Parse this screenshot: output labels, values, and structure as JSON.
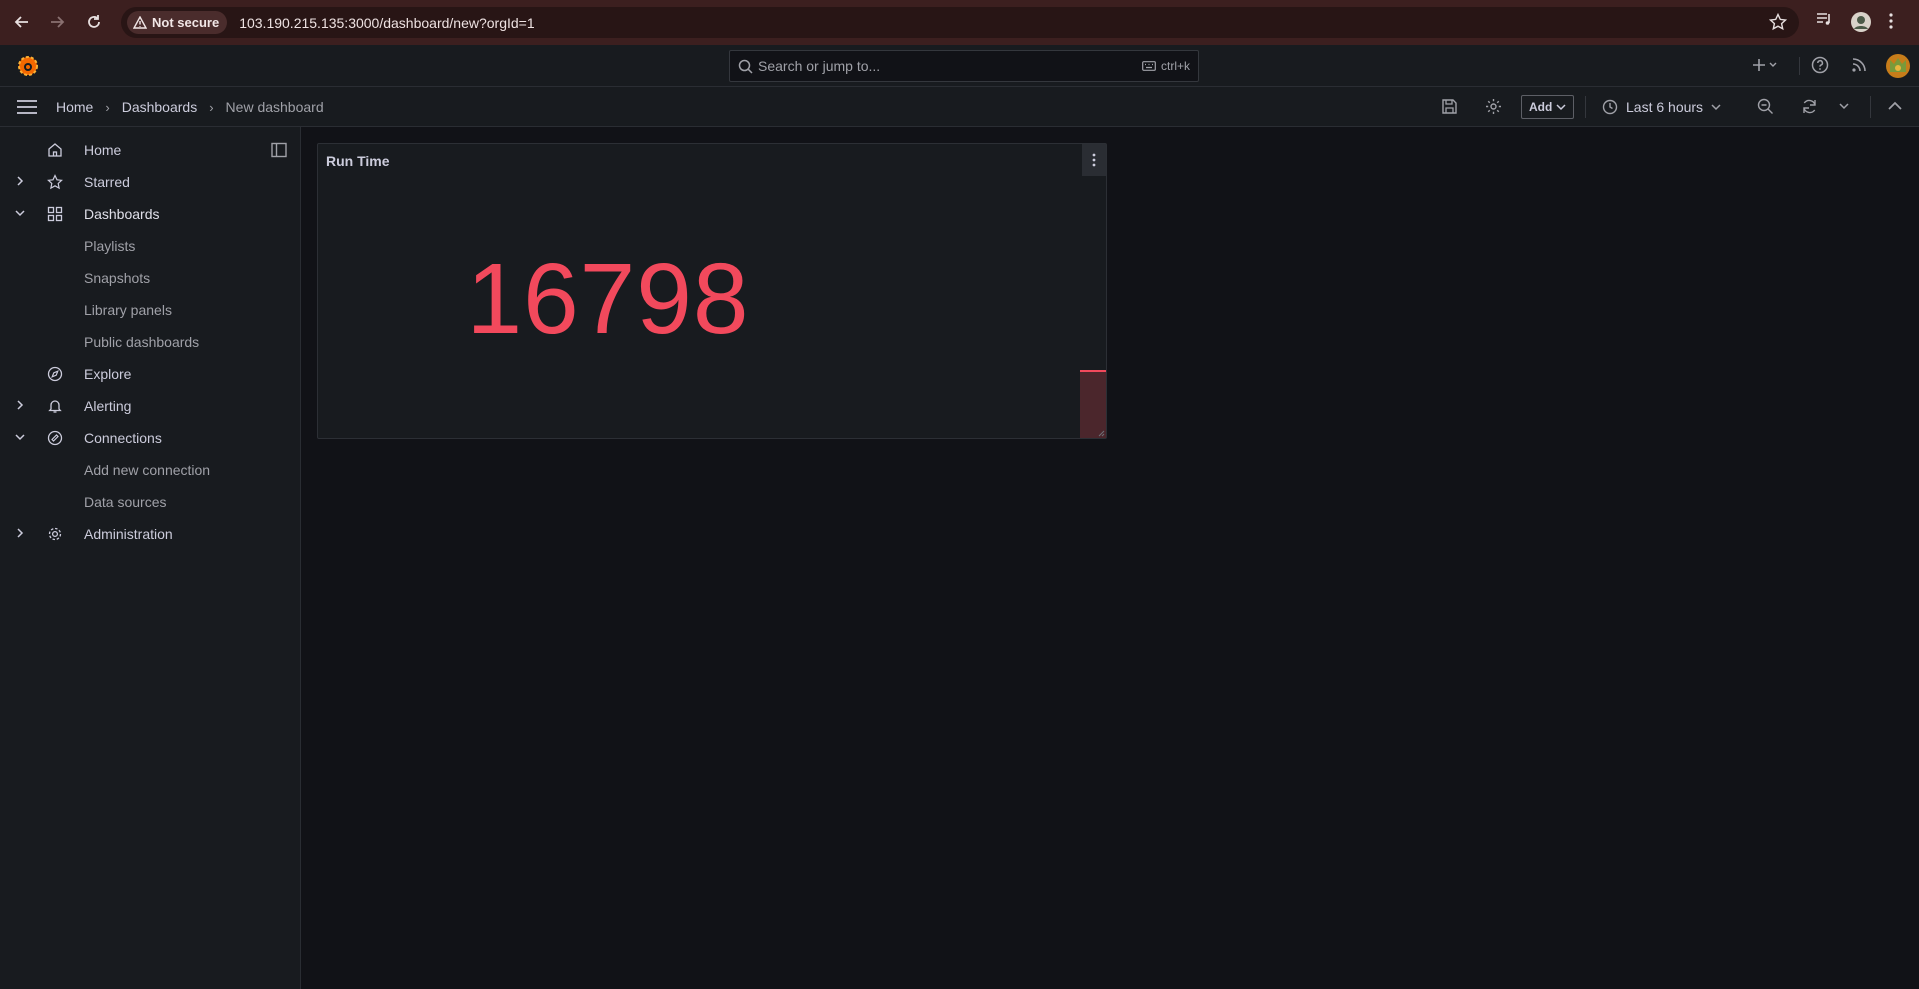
{
  "browser": {
    "security_label": "Not secure",
    "url": "103.190.215.135:3000/dashboard/new?orgId=1"
  },
  "topbar": {
    "search_placeholder": "Search or jump to...",
    "search_shortcut": "ctrl+k"
  },
  "breadcrumb": {
    "items": [
      "Home",
      "Dashboards",
      "New dashboard"
    ]
  },
  "toolbar": {
    "add_label": "Add",
    "time_range": "Last 6 hours"
  },
  "sidebar": {
    "items": [
      {
        "label": "Home"
      },
      {
        "label": "Starred"
      },
      {
        "label": "Dashboards"
      },
      {
        "label": "Playlists"
      },
      {
        "label": "Snapshots"
      },
      {
        "label": "Library panels"
      },
      {
        "label": "Public dashboards"
      },
      {
        "label": "Explore"
      },
      {
        "label": "Alerting"
      },
      {
        "label": "Connections"
      },
      {
        "label": "Add new connection"
      },
      {
        "label": "Data sources"
      },
      {
        "label": "Administration"
      }
    ]
  },
  "panel": {
    "title": "Run Time",
    "value": "16798"
  },
  "colors": {
    "stat_red": "#f2495c",
    "background": "#111217",
    "panel_bg": "#181b1f",
    "grafana_orange": "#f46800"
  }
}
